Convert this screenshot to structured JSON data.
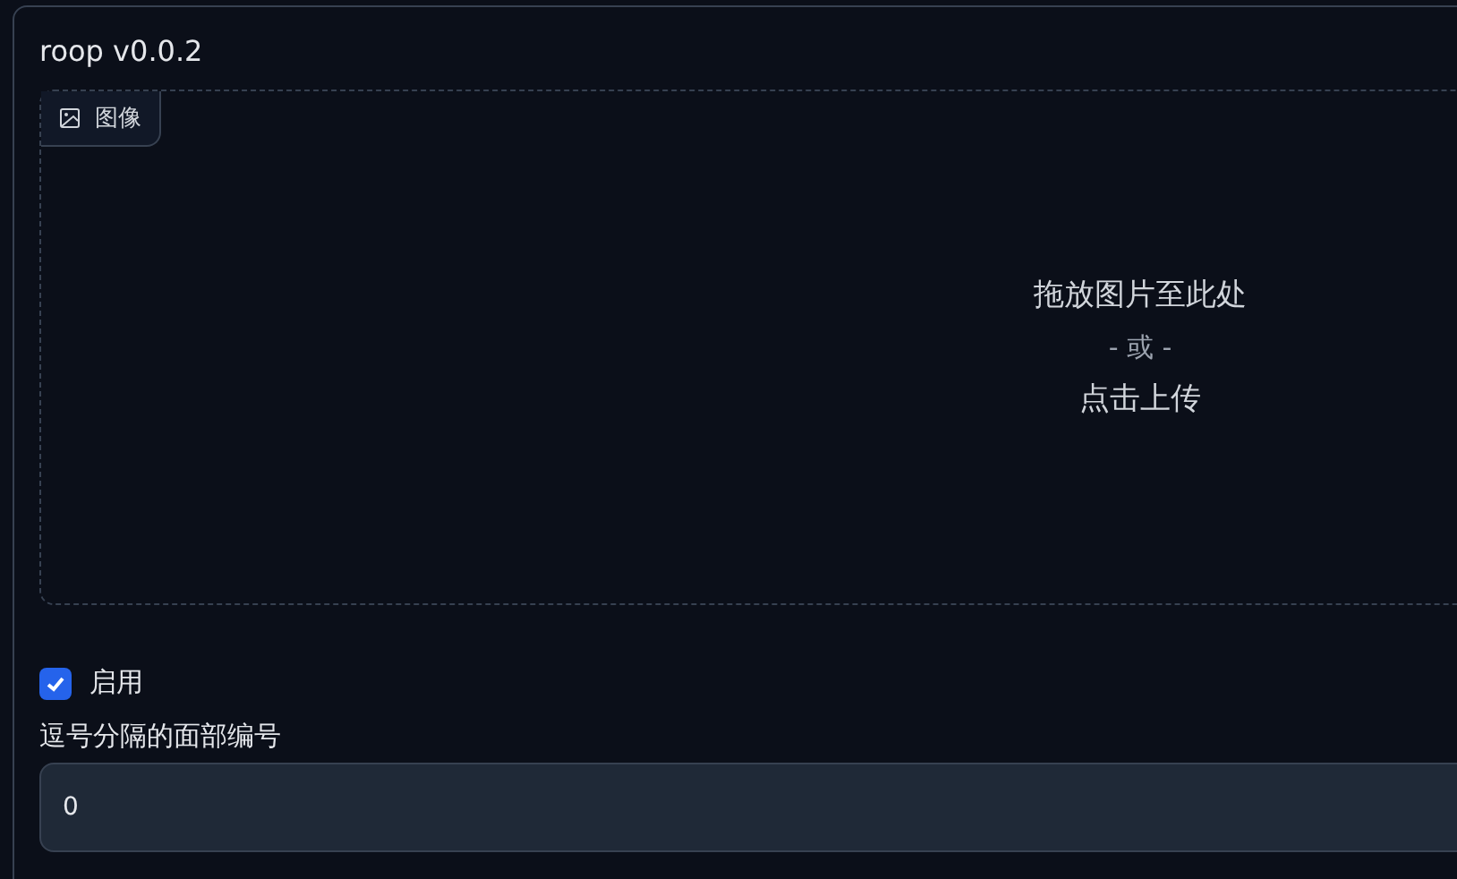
{
  "panel": {
    "title": "roop v0.0.2"
  },
  "image_upload": {
    "label": "图像",
    "drop_text": "拖放图片至此处",
    "or_text": "- 或 -",
    "click_text": "点击上传"
  },
  "enable": {
    "label": "启用",
    "checked": true
  },
  "face_index": {
    "label": "逗号分隔的面部编号",
    "value": "0"
  }
}
